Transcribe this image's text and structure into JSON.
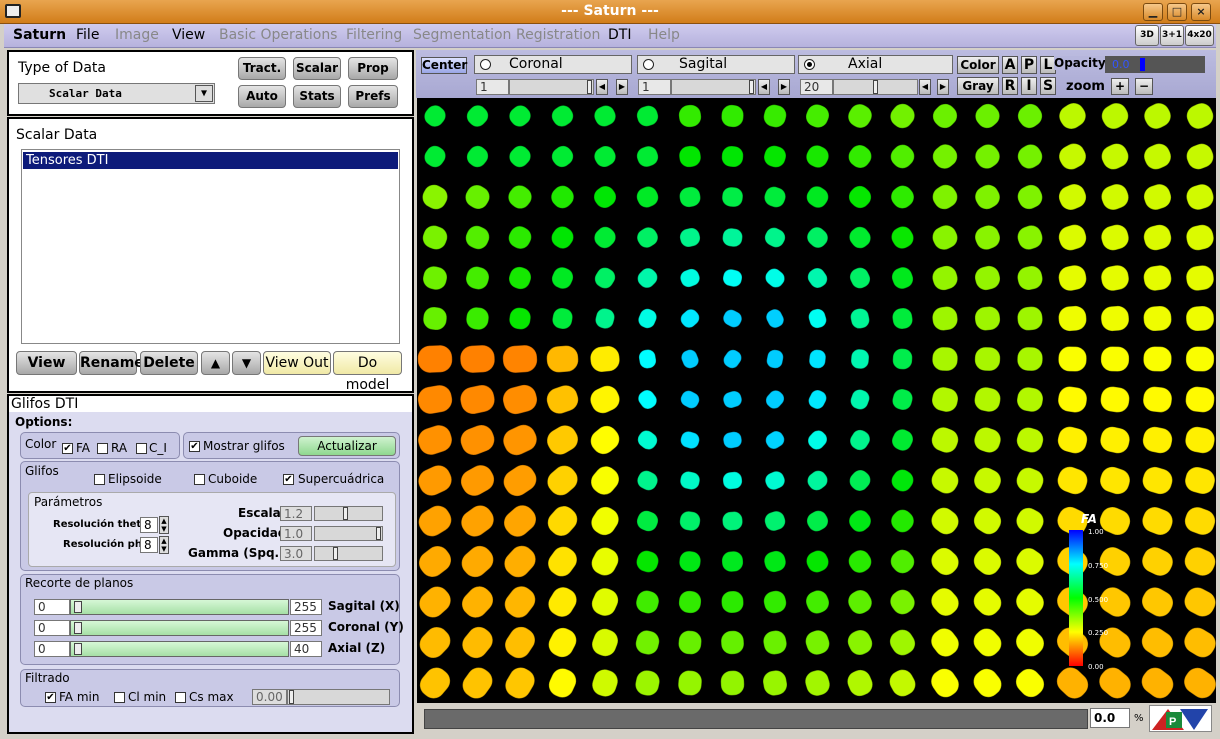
{
  "window": {
    "title": "--- Saturn ---",
    "min": "▁",
    "max": "□",
    "close": "×"
  },
  "menu": [
    {
      "label": "Saturn",
      "enabled": true,
      "bold": true
    },
    {
      "label": "File",
      "enabled": true
    },
    {
      "label": "Image",
      "enabled": false
    },
    {
      "label": "View",
      "enabled": true
    },
    {
      "label": "Basic Operations",
      "enabled": false
    },
    {
      "label": "Filtering",
      "enabled": false
    },
    {
      "label": "Segmentation",
      "enabled": false
    },
    {
      "label": "Registration",
      "enabled": false
    },
    {
      "label": "DTI",
      "enabled": true
    },
    {
      "label": "Help",
      "enabled": false
    }
  ],
  "toolbar": {
    "b3d": "3D",
    "b31": "3+1",
    "b4x20": "4x20"
  },
  "typeData": {
    "title": "Type of Data",
    "select": "Scalar Data",
    "tract": "Tract.",
    "scalar": "Scalar",
    "prop": "Prop",
    "auto": "Auto",
    "stats": "Stats",
    "prefs": "Prefs"
  },
  "scalarData": {
    "title": "Scalar Data",
    "items": [
      "Tensores DTI"
    ],
    "view": "View",
    "rename": "Rename",
    "delete": "Delete",
    "viewout": "View Out",
    "domodel": "Do model"
  },
  "glifos": {
    "title": "Glifos DTI",
    "options": "Options:",
    "color": {
      "label": "Color",
      "fa": "FA",
      "ra": "RA",
      "ci": "C_I",
      "fa_checked": "✔"
    },
    "mostrar": "Mostrar glifos",
    "mostrar_checked": "✔",
    "actualizar": "Actualizar",
    "glifosLabel": "Glifos",
    "elipsoide": "Elipsoide",
    "cuboide": "Cuboide",
    "supercuadrica": "Supercuádrica",
    "super_checked": "✔",
    "parametros": {
      "title": "Parámetros",
      "resTheta": "Resolución theta",
      "resTheta_val": "8",
      "resPhi": "Resolución phi",
      "resPhi_val": "8",
      "escala": "Escala",
      "escala_val": "1.2",
      "opacidad": "Opacidad",
      "opacidad_val": "1.0",
      "gamma": "Gamma (Spq.)",
      "gamma_val": "3.0"
    },
    "recorte": {
      "title": "Recorte de planos",
      "rows": [
        {
          "min": "0",
          "max": "255",
          "label": "Sagital (X)"
        },
        {
          "min": "0",
          "max": "255",
          "label": "Coronal (Y)"
        },
        {
          "min": "0",
          "max": "40",
          "label": "Axial (Z)"
        }
      ]
    },
    "filtrado": {
      "title": "Filtrado",
      "famin": "FA min",
      "famin_checked": "✔",
      "clmin": "Cl min",
      "csmax": "Cs max",
      "value": "0.00"
    }
  },
  "viewer": {
    "center": "Center",
    "coronal": "Coronal",
    "sagital": "Sagital",
    "axial": "Axial",
    "coronal_val": "1",
    "sagital_val": "1",
    "axial_val": "20",
    "color": "Color",
    "gray": "Gray",
    "a": "A",
    "p": "P",
    "l": "L",
    "r": "R",
    "i": "I",
    "s": "S",
    "opacity_label": "Opacity",
    "opacity_val": "0.0",
    "zoom_label": "zoom",
    "zoom_in": "+",
    "zoom_out": "−",
    "status_val": "0.0",
    "status_unit": "%",
    "colorbar": {
      "title": "FA",
      "ticks": [
        "1.00",
        "0.750",
        "0.500",
        "0.250",
        "0.00"
      ]
    }
  }
}
